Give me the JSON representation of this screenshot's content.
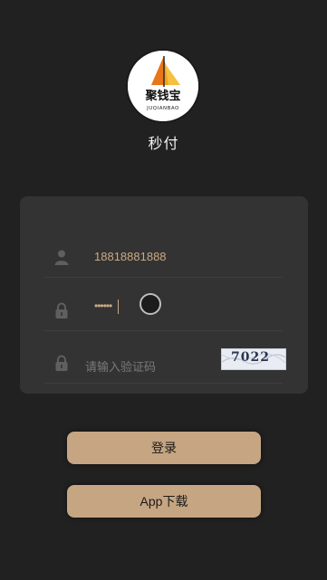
{
  "brand": {
    "logo_text": "聚钱宝",
    "logo_subtext": "JUQIANBAO",
    "title": "秒付"
  },
  "form": {
    "phone": {
      "value": "18818881888",
      "icon": "user-icon"
    },
    "password": {
      "masked_value": "••••••",
      "icon": "lock-icon",
      "toggle_icon": "visibility-toggle-icon"
    },
    "captcha": {
      "placeholder": "请输入验证码",
      "icon": "lock-icon",
      "image_text": "7022"
    }
  },
  "buttons": {
    "login": "登录",
    "download": "App下载"
  },
  "colors": {
    "background": "#212121",
    "panel": "#333333",
    "accent": "#c6a582",
    "text_value": "#cba982"
  }
}
